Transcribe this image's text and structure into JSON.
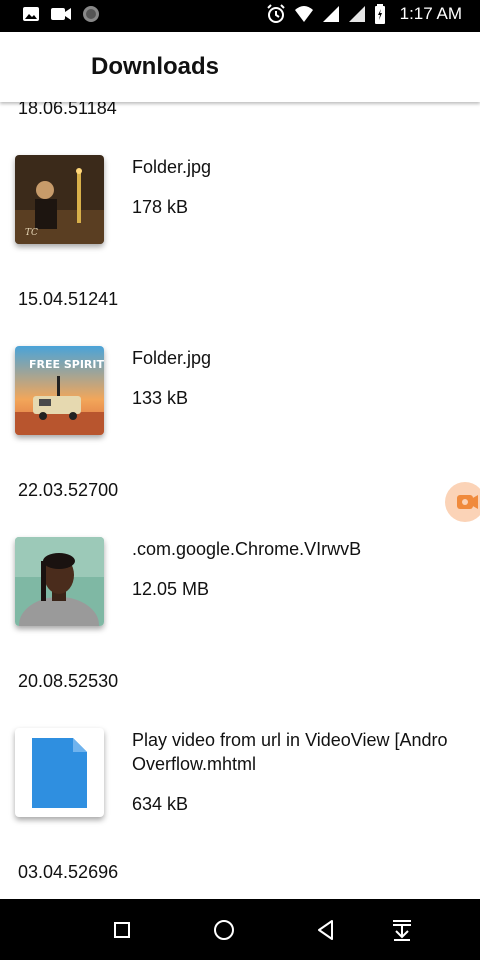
{
  "status_bar": {
    "time": "1:17 AM",
    "left_icons": [
      "image-icon",
      "video-camera-icon",
      "circle-icon"
    ],
    "right_icons": [
      "alarm-icon",
      "wifi-icon",
      "signal-icon",
      "signal-icon",
      "battery-icon"
    ]
  },
  "app_bar": {
    "title": "Downloads"
  },
  "downloads": [
    {
      "date": "18.06.51184",
      "name": "Folder.jpg",
      "size": "178 kB",
      "thumb": "album-art-dark"
    },
    {
      "date": "15.04.51241",
      "name": "Folder.jpg",
      "size": "133 kB",
      "thumb": "album-art-van"
    },
    {
      "date": "22.03.52700",
      "name": ".com.google.Chrome.VIrwvB",
      "size": "12.05 MB",
      "thumb": "portrait-photo"
    },
    {
      "date": "20.08.52530",
      "name": "Play video from url in VideoView [Andro Overflow.mhtml",
      "size": "634 kB",
      "thumb": "document-file-icon"
    },
    {
      "date": "03.04.52696"
    }
  ],
  "nav_bar": {
    "icons": [
      "recent-apps-icon",
      "home-icon",
      "back-icon",
      "download-status-icon"
    ]
  },
  "colors": {
    "status_bg": "#000000",
    "doc_icon": "#2f8fe0",
    "fab_bg": "#fbd3b7",
    "fab_icon": "#f08a3c"
  }
}
